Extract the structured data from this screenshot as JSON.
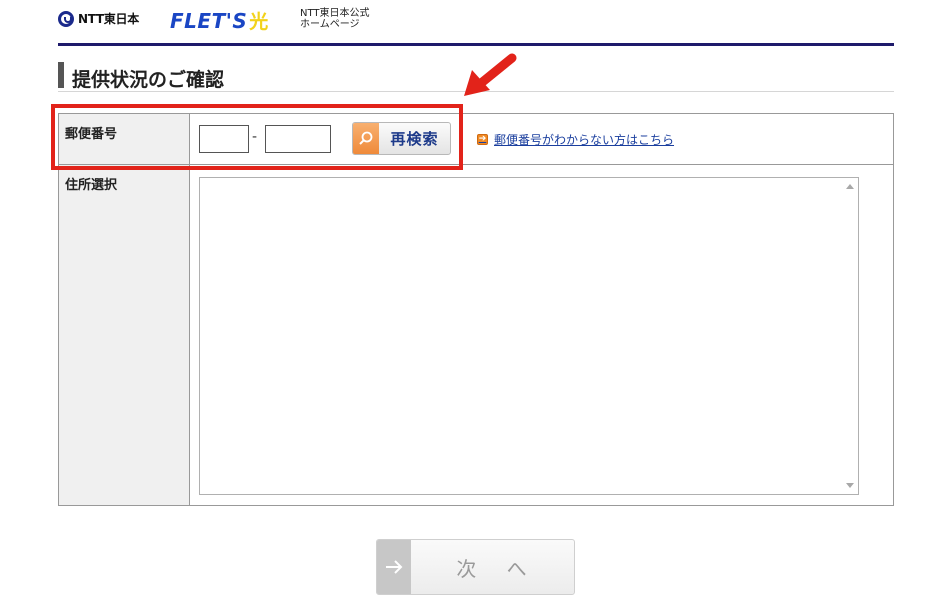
{
  "header": {
    "ntt_logo_text": "NTT東日本",
    "flets_text": "FLET'S",
    "flets_hikari": "光",
    "official_line1": "NTT東日本公式",
    "official_line2": "ホームページ"
  },
  "page": {
    "title": "提供状況のご確認"
  },
  "form": {
    "postal_label": "郵便番号",
    "zip1_value": "",
    "zip2_value": "",
    "dash": "-",
    "research_button": "再検索",
    "help_link": "郵便番号がわからない方はこちら",
    "address_label": "住所選択",
    "address_options": []
  },
  "footer": {
    "next_button": "次 へ"
  },
  "colors": {
    "header_rule": "#1e1a6b",
    "highlight": "#e2231a",
    "search_icon_bg": "#ef8a3a",
    "link": "#1a3e9e"
  },
  "icons": {
    "logo": "ntt-mark-icon",
    "search": "magnifier-icon",
    "link_arrow": "arrow-right-icon",
    "next_arrow": "arrow-right-icon",
    "annotation": "red-arrow-icon"
  }
}
